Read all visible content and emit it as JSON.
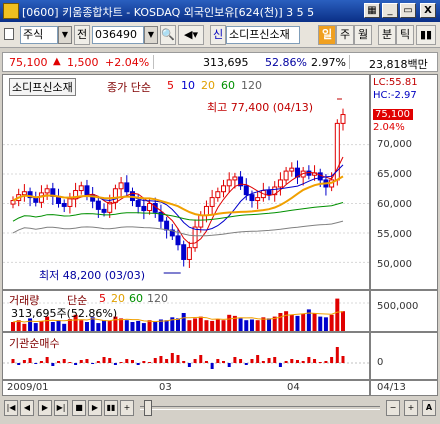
{
  "window": {
    "title": "[0600] 키움종합차트 - KOSDAQ 외국인보유[624(천)] 3 5 5",
    "minimize": "_",
    "restore": "▭",
    "close": "X"
  },
  "toolbar": {
    "mode": "주식",
    "prev_label": "전",
    "code": "036490",
    "stock_name": "소디프신소재",
    "tag_shin": "신",
    "btn_il": "일",
    "btn_ju": "주",
    "btn_wol": "월",
    "btn_bun": "분",
    "btn_tik": "틱"
  },
  "quote": {
    "price": "75,100",
    "change": "1,500",
    "change_pct": "+2.04%",
    "volume": "313,695",
    "ratio1": "52.86%",
    "ratio2": "2.97%",
    "amount": "23,818백만"
  },
  "price_panel": {
    "stock_label": "소디프신소재",
    "ma_title": "종가 단순",
    "ma_periods": [
      "5",
      "10",
      "20",
      "60",
      "120"
    ],
    "lc": "LC:55.81",
    "hc": "HC:-2.97",
    "high_label": "최고 77,400 (04/13)",
    "low_label": "최저 48,200 (03/03)",
    "current_price": "75,100",
    "current_pct": "2.04%",
    "y_ticks": [
      "70,000",
      "65,000",
      "60,000",
      "55,000",
      "50,000"
    ]
  },
  "volume_panel": {
    "title": "거래량",
    "ma_title": "단순",
    "ma_periods": [
      "5",
      "20",
      "60",
      "120"
    ],
    "value_label": "313,695주(52.86%)",
    "y_tick": "500,000"
  },
  "inst_panel": {
    "title": "기관순매수",
    "y_tick": "0"
  },
  "x_axis": {
    "labels": [
      "2009/01",
      "03",
      "04"
    ],
    "right_date": "04/13"
  },
  "colors": {
    "up": "#e00000",
    "down": "#0000cc",
    "ma5": "#e00000",
    "ma10": "#0000cc",
    "ma20": "#f0a000",
    "ma60": "#009000",
    "ma120": "#808080"
  },
  "chart_data": {
    "type": "candlestick",
    "x_range": [
      "2009/01",
      "04/13"
    ],
    "y_range": [
      48200,
      77400
    ],
    "last_close": 75100,
    "period_high": {
      "value": 77400,
      "date": "04/13"
    },
    "period_low": {
      "value": 48200,
      "date": "03/03"
    },
    "closes": [
      60500,
      61500,
      62000,
      61000,
      60200,
      61800,
      62500,
      61200,
      60000,
      59500,
      60800,
      62200,
      63000,
      61500,
      60400,
      59000,
      58500,
      60200,
      62500,
      63500,
      62000,
      60500,
      59500,
      58800,
      60000,
      58500,
      57000,
      55500,
      54500,
      53000,
      50500,
      52500,
      56000,
      58000,
      59500,
      61000,
      62000,
      63000,
      64000,
      64500,
      63000,
      61500,
      60500,
      61000,
      62200,
      61500,
      62800,
      64000,
      65500,
      66000,
      64500,
      65500,
      64800,
      65200,
      64000,
      62800,
      64000,
      73600,
      75100
    ],
    "volume_bars": [
      0.25,
      0.3,
      0.2,
      0.35,
      0.22,
      0.28,
      0.4,
      0.25,
      0.3,
      0.2,
      0.33,
      0.45,
      0.3,
      0.25,
      0.38,
      0.22,
      0.3,
      0.28,
      0.4,
      0.35,
      0.3,
      0.25,
      0.28,
      0.22,
      0.3,
      0.26,
      0.32,
      0.3,
      0.38,
      0.35,
      0.5,
      0.3,
      0.35,
      0.4,
      0.3,
      0.28,
      0.33,
      0.3,
      0.45,
      0.42,
      0.35,
      0.3,
      0.32,
      0.3,
      0.38,
      0.35,
      0.4,
      0.5,
      0.55,
      0.45,
      0.42,
      0.48,
      0.6,
      0.5,
      0.4,
      0.38,
      0.45,
      0.9,
      0.55
    ],
    "inst_net": [
      0.2,
      -0.1,
      0.15,
      0.25,
      -0.05,
      0.1,
      0.3,
      -0.15,
      0.1,
      0.2,
      0.05,
      -0.1,
      0.15,
      0.2,
      -0.05,
      0.1,
      0.3,
      0.25,
      -0.1,
      0.05,
      0.2,
      0.15,
      -0.1,
      0.1,
      0.05,
      0.25,
      0.35,
      0.2,
      0.5,
      0.4,
      0.1,
      -0.2,
      0.2,
      0.4,
      0.1,
      -0.3,
      0.2,
      0.1,
      -0.2,
      0.3,
      0.2,
      -0.1,
      0.2,
      0.4,
      0.1,
      0.25,
      0.3,
      -0.2,
      0.1,
      0.2,
      0.15,
      0.1,
      0.3,
      0.2,
      0.05,
      0.1,
      0.3,
      0.8,
      0.35
    ]
  }
}
